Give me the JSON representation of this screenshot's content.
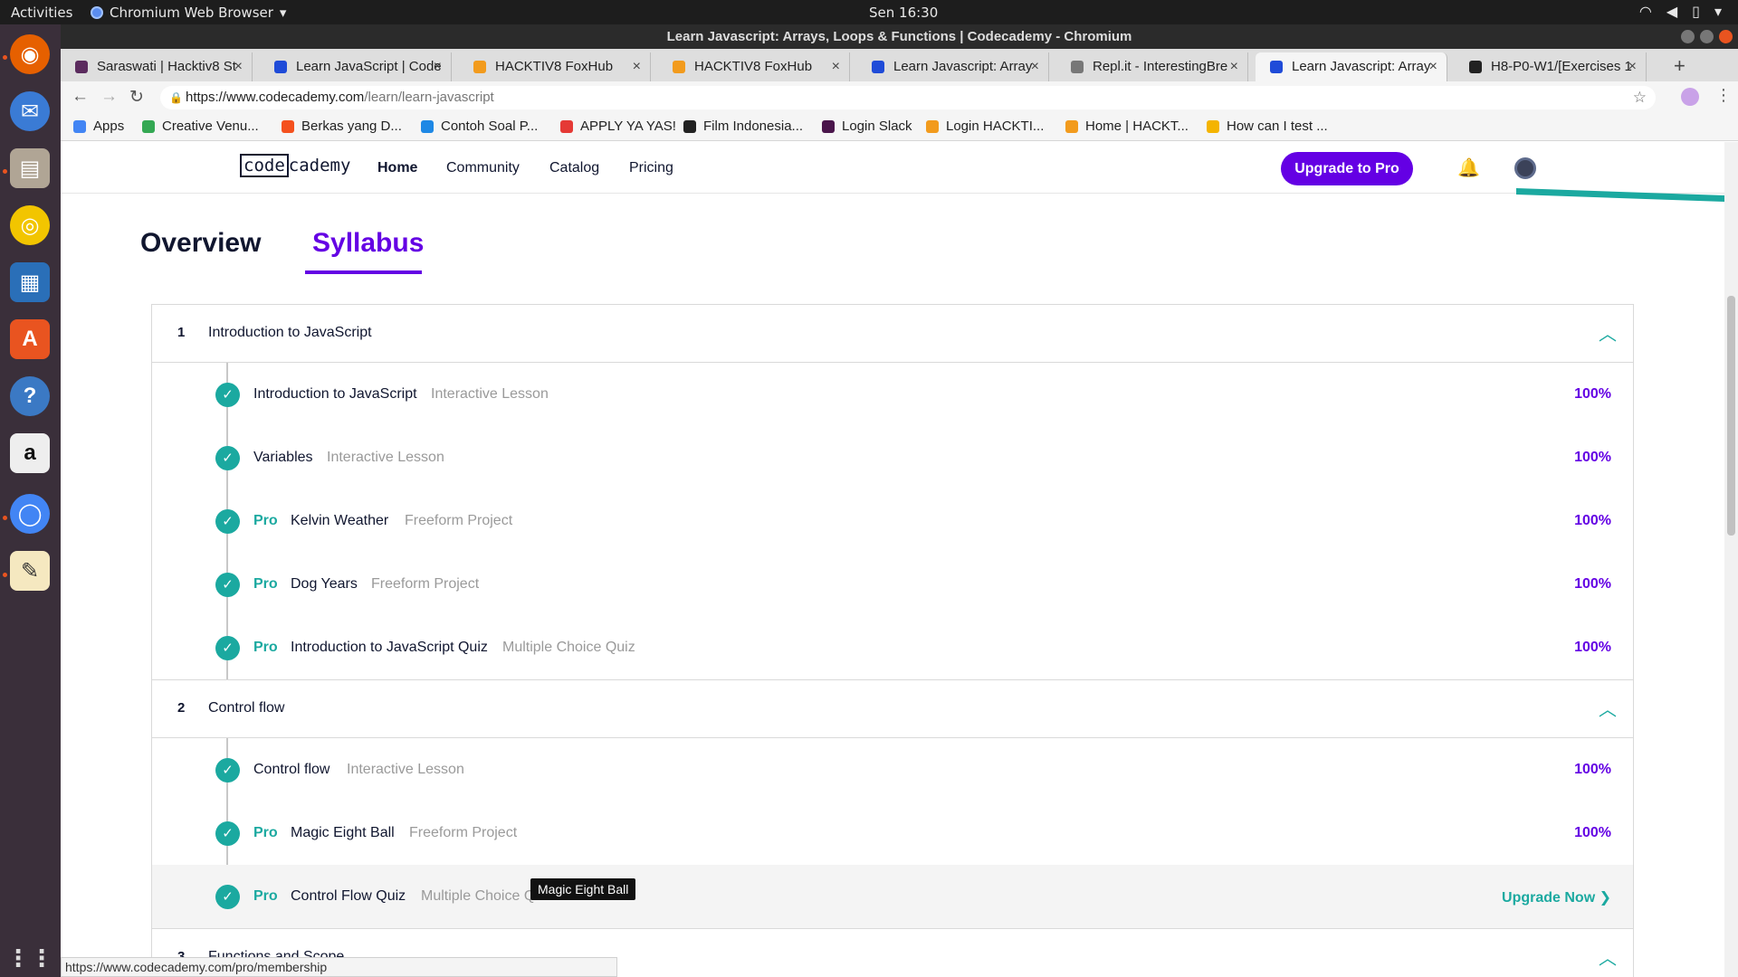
{
  "system": {
    "activities": "Activities",
    "app_name": "Chromium Web Browser",
    "clock": "Sen 16:30"
  },
  "window": {
    "title": "Learn Javascript: Arrays, Loops & Functions | Codecademy - Chromium"
  },
  "tabs": [
    {
      "label": "Saraswati | Hacktiv8 St",
      "color": "#5b2b5e"
    },
    {
      "label": "Learn JavaScript | Code",
      "color": "#1f4bd8"
    },
    {
      "label": "HACKTIV8 FoxHub",
      "color": "#f29b1d"
    },
    {
      "label": "HACKTIV8 FoxHub",
      "color": "#f29b1d"
    },
    {
      "label": "Learn Javascript: Array",
      "color": "#1f4bd8"
    },
    {
      "label": "Repl.it - InterestingBre",
      "color": "#777777"
    },
    {
      "label": "Learn Javascript: Array",
      "color": "#1f4bd8"
    },
    {
      "label": "H8-P0-W1/[Exercises 1",
      "color": "#222222"
    }
  ],
  "address": {
    "host": "https://www.codecademy.com",
    "path": "/learn/learn-javascript"
  },
  "bookmarks": [
    {
      "label": "Apps",
      "color": "#4285f4"
    },
    {
      "label": "Creative Venu...",
      "color": "#34a853"
    },
    {
      "label": "Berkas yang D...",
      "color": "#f4511e"
    },
    {
      "label": "Contoh Soal P...",
      "color": "#1e88e5"
    },
    {
      "label": "APPLY YA YAS!",
      "color": "#e53935"
    },
    {
      "label": "Film Indonesia...",
      "color": "#222222"
    },
    {
      "label": "Login Slack",
      "color": "#4a154b"
    },
    {
      "label": "Login HACKTI...",
      "color": "#f29b1d"
    },
    {
      "label": "Home | HACKT...",
      "color": "#f29b1d"
    },
    {
      "label": "How can I test ...",
      "color": "#f4b400"
    }
  ],
  "site": {
    "logo_left": "code",
    "logo_right": "cademy",
    "nav": [
      "Home",
      "Community",
      "Catalog",
      "Pricing"
    ],
    "upgrade_label": "Upgrade to Pro",
    "tabs": {
      "overview": "Overview",
      "syllabus": "Syllabus"
    }
  },
  "modules": [
    {
      "number": "1",
      "title": "Introduction to JavaScript",
      "lessons": [
        {
          "pro": "",
          "name": "Introduction to JavaScript",
          "type": "Interactive Lesson",
          "status": "100%"
        },
        {
          "pro": "",
          "name": "Variables",
          "type": "Interactive Lesson",
          "status": "100%"
        },
        {
          "pro": "Pro",
          "name": "Kelvin Weather",
          "type": "Freeform Project",
          "status": "100%"
        },
        {
          "pro": "Pro",
          "name": "Dog Years",
          "type": "Freeform Project",
          "status": "100%"
        },
        {
          "pro": "Pro",
          "name": "Introduction to JavaScript Quiz",
          "type": "Multiple Choice Quiz",
          "status": "100%"
        }
      ]
    },
    {
      "number": "2",
      "title": "Control flow",
      "lessons": [
        {
          "pro": "",
          "name": "Control flow",
          "type": "Interactive Lesson",
          "status": "100%"
        },
        {
          "pro": "Pro",
          "name": "Magic Eight Ball",
          "type": "Freeform Project",
          "status": "100%"
        },
        {
          "pro": "Pro",
          "name": "Control Flow Quiz",
          "type": "Multiple Choice Q",
          "status": "Upgrade Now ❯"
        }
      ]
    },
    {
      "number": "3",
      "title": "Functions and Scope",
      "lessons": []
    }
  ],
  "tooltip": "Magic Eight Ball",
  "status_url": "https://www.codecademy.com/pro/membership",
  "colors": {
    "accent": "#6400e4",
    "teal": "#1ba9a0"
  }
}
